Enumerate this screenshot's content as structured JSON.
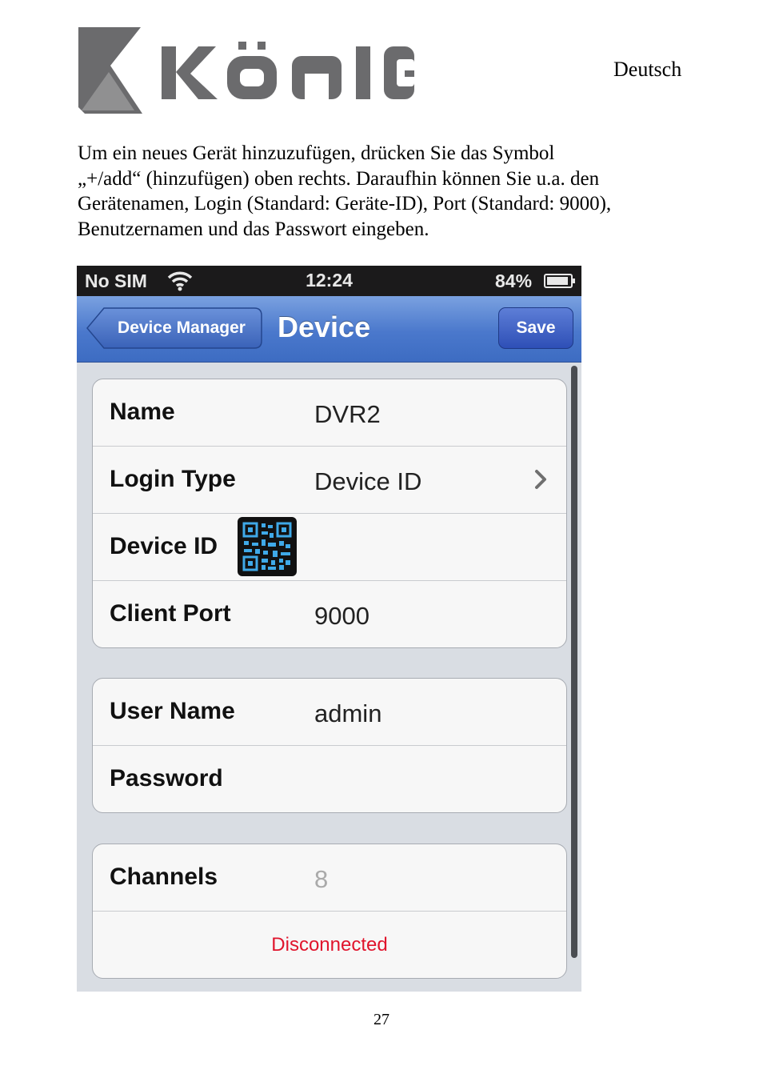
{
  "header": {
    "brand": "KÖNIG",
    "language": "Deutsch"
  },
  "intro": {
    "lines": [
      "Um ein neues Gerät hinzuzufügen, drücken Sie das Symbol",
      "„+/add“ (hinzufügen) oben rechts. Daraufhin können Sie u.a. den",
      "Gerätenamen, Login (Standard: Geräte-ID), Port (Standard: 9000),",
      "Benutzernamen und das Passwort eingeben."
    ]
  },
  "phone": {
    "status_bar": {
      "carrier": "No SIM",
      "time": "12:24",
      "battery": "84%"
    },
    "nav": {
      "back_label": "Device Manager",
      "title": "Device",
      "save_label": "Save"
    },
    "group1": {
      "name_label": "Name",
      "name_value": "DVR2",
      "login_type_label": "Login Type",
      "login_type_value": "Device ID",
      "device_id_label": "Device ID",
      "client_port_label": "Client Port",
      "client_port_value": "9000"
    },
    "group2": {
      "user_name_label": "User Name",
      "user_name_value": "admin",
      "password_label": "Password",
      "password_value": ""
    },
    "group3": {
      "channels_label": "Channels",
      "channels_value": "8",
      "status": "Disconnected"
    },
    "colors": {
      "nav_blue": "#4a78cc",
      "status_red": "#e0142c"
    },
    "icons": [
      "wifi-icon",
      "battery-icon",
      "back-arrow-icon",
      "chevron-right-icon",
      "qr-code-icon"
    ]
  },
  "footer": {
    "page_number": "27"
  }
}
